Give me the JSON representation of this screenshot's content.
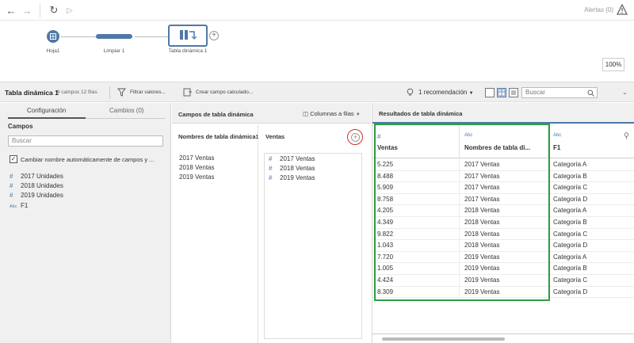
{
  "topbar": {
    "alerts_label": "Alertas (0)"
  },
  "flow": {
    "nodes": [
      {
        "label": "Hoja1"
      },
      {
        "label": "Limpiar 1"
      },
      {
        "label": "Tabla dinámica 1"
      }
    ],
    "zoom": "100%"
  },
  "stepbar": {
    "title": "Tabla dinámica 1",
    "meta": "6 campos  12 filas",
    "filter_label": "Filtrar valores...",
    "calc_label": "Crear campo calculado...",
    "recommendation": "1 recomendación",
    "search_placeholder": "Buscar"
  },
  "left_panel": {
    "tabs": [
      "Configuración",
      "Cambios (0)"
    ],
    "fields_title": "Campos",
    "search_placeholder": "Buscar",
    "checkbox_label": "Cambiar nombre automáticamente de campos y ...",
    "fields": [
      {
        "type": "#",
        "name": "2017 Unidades"
      },
      {
        "type": "#",
        "name": "2018 Unidades"
      },
      {
        "type": "#",
        "name": "2019 Unidades"
      },
      {
        "type": "Abc",
        "name": "F1"
      }
    ]
  },
  "middle_panel": {
    "title": "Campos de tabla dinámica",
    "mode": "Columnas a filas",
    "names_header": "Nombres de tabla dinámica1",
    "values_header": "Ventas",
    "names": [
      "2017 Ventas",
      "2018 Ventas",
      "2019 Ventas"
    ],
    "values": [
      {
        "type": "#",
        "name": "2017 Ventas"
      },
      {
        "type": "#",
        "name": "2018 Ventas"
      },
      {
        "type": "#",
        "name": "2019 Ventas"
      }
    ]
  },
  "right_panel": {
    "title": "Resultados de tabla dinámica",
    "columns": [
      {
        "type": "#",
        "name": "Ventas"
      },
      {
        "type": "Abc",
        "name": "Nombres de tabla di..."
      },
      {
        "type": "Abc",
        "name": "F1"
      }
    ],
    "rows": [
      [
        "5.225",
        "2017 Ventas",
        "Categoría A"
      ],
      [
        "8.488",
        "2017 Ventas",
        "Categoría B"
      ],
      [
        "5.909",
        "2017 Ventas",
        "Categoría C"
      ],
      [
        "8.758",
        "2017 Ventas",
        "Categoría D"
      ],
      [
        "4.205",
        "2018 Ventas",
        "Categoría A"
      ],
      [
        "4.349",
        "2018 Ventas",
        "Categoría B"
      ],
      [
        "9.822",
        "2018 Ventas",
        "Categoría C"
      ],
      [
        "1.043",
        "2018 Ventas",
        "Categoría D"
      ],
      [
        "7.720",
        "2019 Ventas",
        "Categoría A"
      ],
      [
        "1.005",
        "2019 Ventas",
        "Categoría B"
      ],
      [
        "4.424",
        "2019 Ventas",
        "Categoría C"
      ],
      [
        "8.309",
        "2019 Ventas",
        "Categoría D"
      ]
    ]
  },
  "colors": {
    "accent": "#4e79a7",
    "highlight_box": "#2e9e44",
    "annotation_circle": "#d32f2f"
  }
}
